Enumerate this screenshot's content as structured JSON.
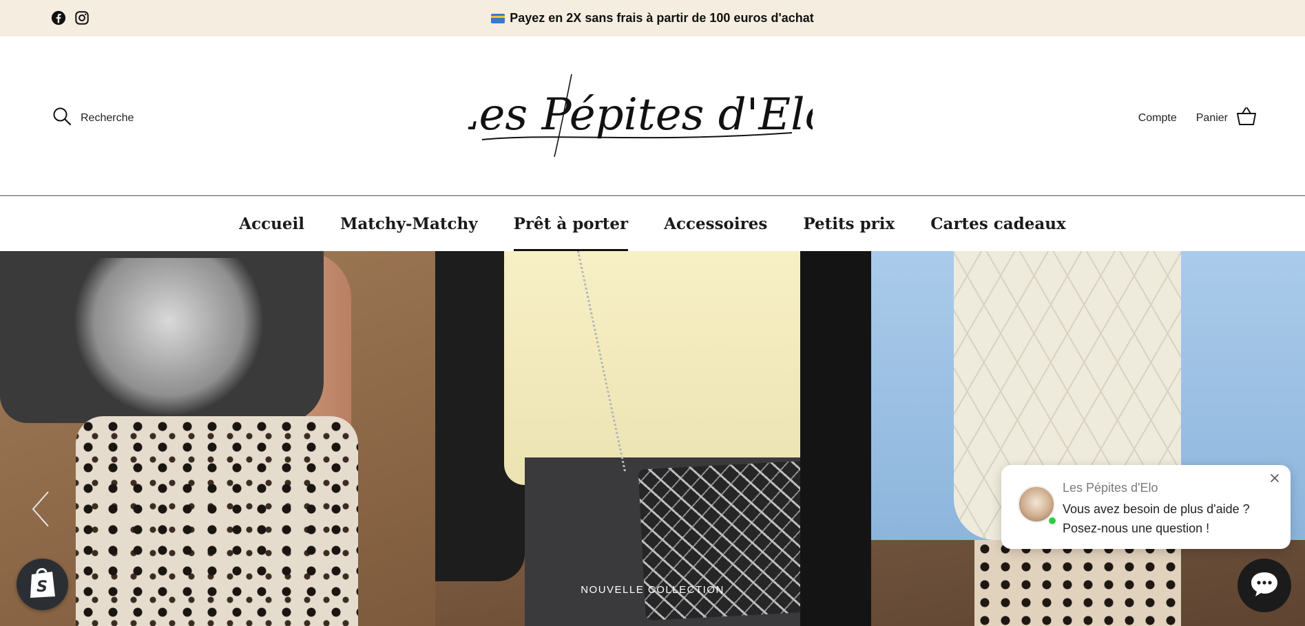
{
  "announcement": {
    "text": "Payez en 2X sans frais à partir de 100 euros d'achat",
    "emoji": "credit-card-emoji",
    "social": [
      "facebook-icon",
      "instagram-icon"
    ]
  },
  "header": {
    "search_label": "Recherche",
    "logo_text": "Les Pépites d'Elo",
    "account_label": "Compte",
    "cart_label": "Panier"
  },
  "nav": {
    "items": [
      {
        "label": "Accueil",
        "active": false
      },
      {
        "label": "Matchy-Matchy",
        "active": false
      },
      {
        "label": "Prêt à porter",
        "active": true
      },
      {
        "label": "Accessoires",
        "active": false
      },
      {
        "label": "Petits prix",
        "active": false
      },
      {
        "label": "Cartes cadeaux",
        "active": false
      }
    ]
  },
  "hero": {
    "caption": "NOUVELLE COLLECTION"
  },
  "chat": {
    "name": "Les Pépites d'Elo",
    "message": "Vous avez besoin de plus d'aide ? Posez-nous une question !"
  },
  "colors": {
    "announcement_bg": "#f4ede0",
    "chat_online": "#2ecc40",
    "shopify_badge": "#2b2f33"
  }
}
